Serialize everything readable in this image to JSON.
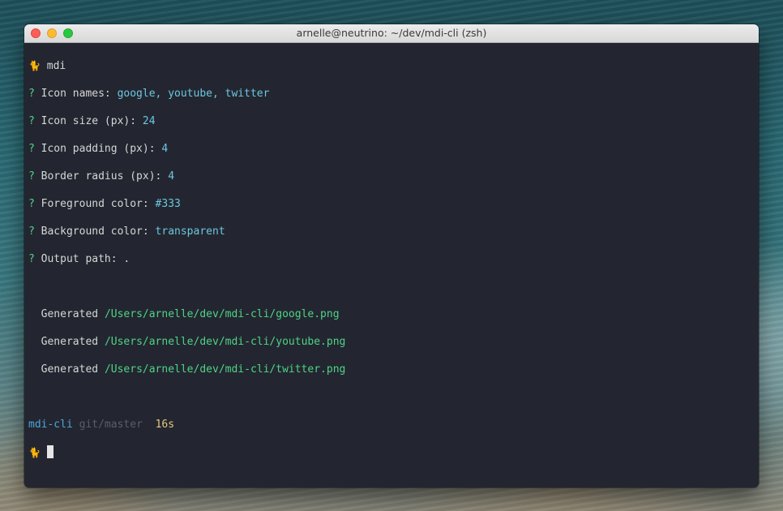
{
  "window": {
    "title": "arnelle@neutrino: ~/dev/mdi-cli (zsh)"
  },
  "terminal": {
    "prompt_symbol": "🐈",
    "command": "mdi",
    "question_mark": "?",
    "answers": [
      {
        "label": "Icon names:",
        "value": "google, youtube, twitter"
      },
      {
        "label": "Icon size (px):",
        "value": "24"
      },
      {
        "label": "Icon padding (px):",
        "value": "4"
      },
      {
        "label": "Border radius (px):",
        "value": "4"
      },
      {
        "label": "Foreground color:",
        "value": "#333"
      },
      {
        "label": "Background color:",
        "value": "transparent"
      },
      {
        "label": "Output path:",
        "value": "."
      }
    ],
    "generated_label": "Generated",
    "generated_files": [
      "/Users/arnelle/dev/mdi-cli/google.png",
      "/Users/arnelle/dev/mdi-cli/youtube.png",
      "/Users/arnelle/dev/mdi-cli/twitter.png"
    ],
    "status": {
      "directory": "mdi-cli",
      "git_branch": "git/master",
      "elapsed": "16s"
    }
  }
}
